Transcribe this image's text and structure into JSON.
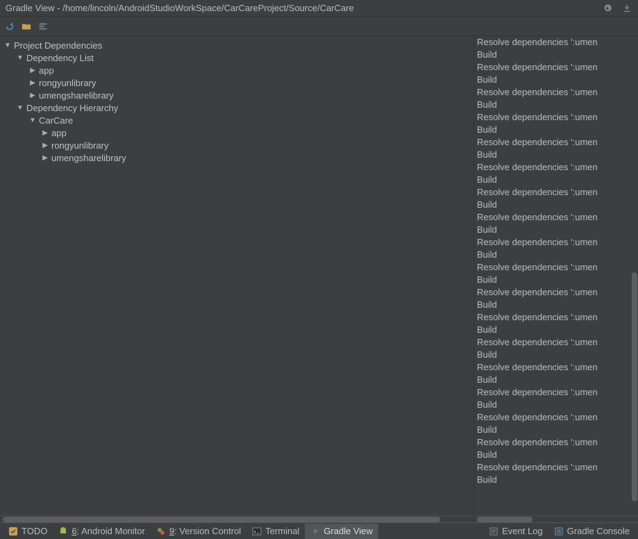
{
  "header": {
    "title": "Gradle View - /home/lincoln/AndroidStudioWorkSpace/CarCareProject/Source/CarCare"
  },
  "tree": {
    "root": "Project Dependencies",
    "depList": "Dependency List",
    "depListItems": [
      "app",
      "rongyunlibrary",
      "umengsharelibrary"
    ],
    "depHier": "Dependency Hierarchy",
    "hierRoot": "CarCare",
    "hierItems": [
      "app",
      "rongyunlibrary",
      "umengsharelibrary"
    ]
  },
  "log": {
    "resolve": "Resolve dependencies ':umen",
    "build": "Build",
    "pairs": 18
  },
  "bottom": {
    "todo": "TODO",
    "android": ": Android Monitor",
    "androidKey": "6",
    "version": ": Version Control",
    "versionKey": "9",
    "terminal": "Terminal",
    "gradleView": "Gradle View",
    "eventLog": "Event Log",
    "gradleConsole": "Gradle Console"
  }
}
